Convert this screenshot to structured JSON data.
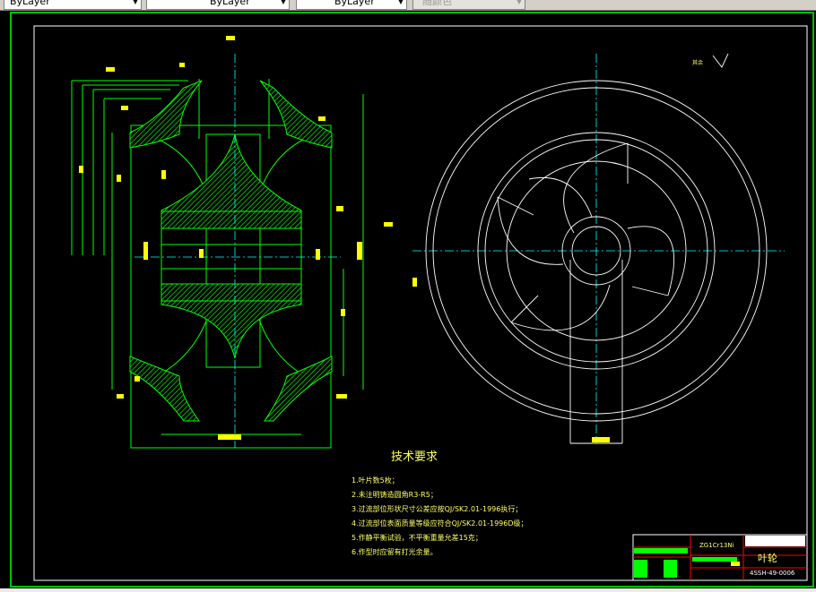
{
  "toolbar": {
    "color_dropdown": "ByLayer",
    "linetype_dropdown": "ByLayer",
    "lineweight_dropdown": "ByLayer",
    "plotstyle_dropdown": "随颜色"
  },
  "drawing": {
    "surface_mark": "其余",
    "tech_requirements": {
      "title": "技术要求",
      "items": [
        "1.叶片数5枚；",
        "2.未注明铸造圆角R3-R5；",
        "3.过流部位形状尺寸公差应按QJ/SK2.01-1996执行；",
        "4.过流部位表面质量等级应符合QJ/SK2.01-1996D级；",
        "5.作静平衡试验，不平衡重量允差15克；",
        "6.作型时应留有打光余量。"
      ]
    },
    "title_block": {
      "material": "ZG1Cr13Ni",
      "part_name": "叶轮",
      "drawing_number": "4SSH-49-0006"
    }
  },
  "colors": {
    "frame": "#ffffff",
    "outline": "#00ff00",
    "dimension": "#ffff00",
    "border": "#00c000",
    "title_red": "#ff0000"
  }
}
